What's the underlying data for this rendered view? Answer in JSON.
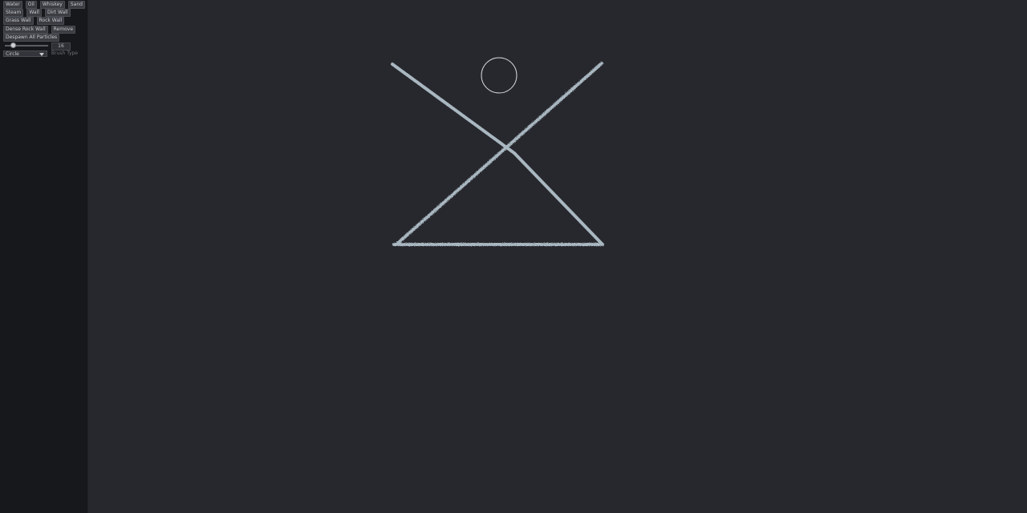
{
  "panel": {
    "buttons_row1": [
      "Water",
      "Oil",
      "Whiskey",
      "Sand"
    ],
    "buttons_row2": [
      "Steam",
      "Wall",
      "Dirt Wall"
    ],
    "buttons_row3": [
      "Grass Wall",
      "Rock Wall"
    ],
    "buttons_row4": [
      "Dense Rock Wall",
      "Remove"
    ],
    "despawn_label": "Despawn All Particles",
    "brush_size": "16",
    "brush_size_fraction": 0.2,
    "brush_type_value": "Circle",
    "brush_type_label": "Brush Type"
  },
  "colors": {
    "background": "#27282d",
    "panel": "#17181b",
    "wall_particles": "#a9b7c1"
  }
}
